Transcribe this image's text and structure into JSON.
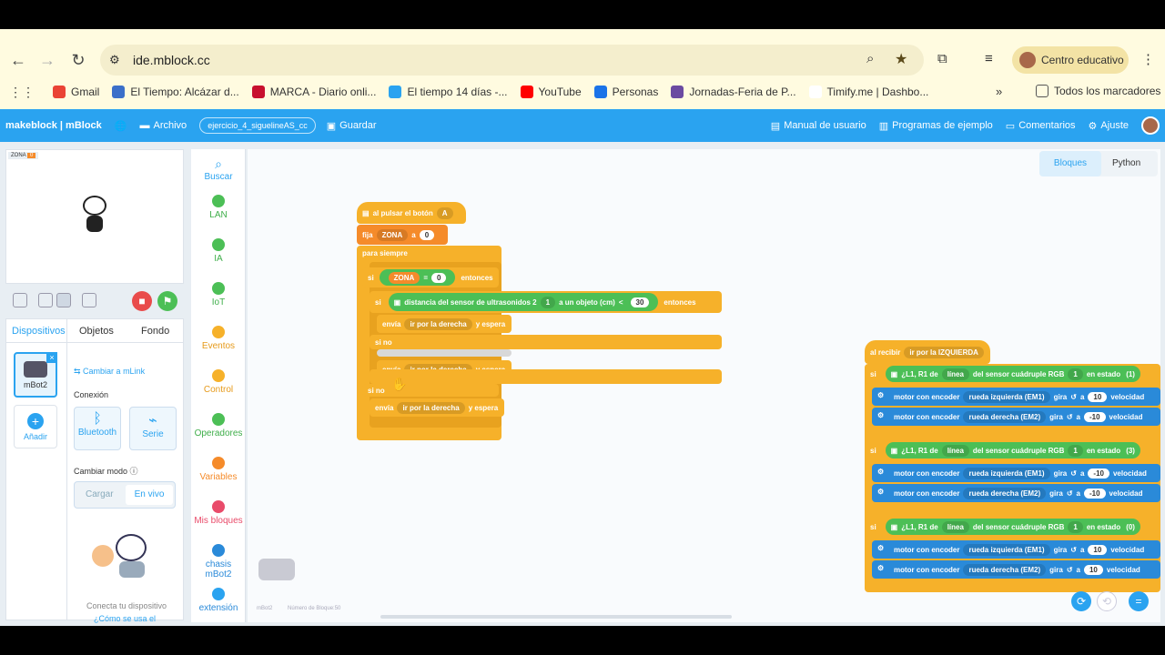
{
  "browser": {
    "url": "ide.mblock.cc",
    "profile_label": "Centro educativo",
    "bookmarks": [
      {
        "label": "Gmail",
        "color": "#ea4335"
      },
      {
        "label": "El Tiempo: Alcázar d...",
        "color": "#3b6fc9"
      },
      {
        "label": "MARCA - Diario onli...",
        "color": "#c8102e"
      },
      {
        "label": "El tiempo 14 días -...",
        "color": "#2aa3f0"
      },
      {
        "label": "YouTube",
        "color": "#ff0000"
      },
      {
        "label": "Personas",
        "color": "#1a73e8"
      },
      {
        "label": "Jornadas-Feria de P...",
        "color": "#6b4aa1"
      },
      {
        "label": "Timify.me | Dashbo...",
        "color": "#ffffff"
      }
    ],
    "all_bookmarks_label": "Todos los marcadores"
  },
  "mblock": {
    "logo": "makeblock | mBlock",
    "archivo": "Archivo",
    "project_name": "ejercicio_4_siguelineAS_cc",
    "guardar": "Guardar",
    "manual": "Manual de usuario",
    "ejemplos": "Programas de ejemplo",
    "comentarios": "Comentarios",
    "ajuste": "Ajuste"
  },
  "stage": {
    "variable_label": "ZONA",
    "variable_value": "0"
  },
  "devices_panel": {
    "tabs": [
      "Dispositivos",
      "Objetos",
      "Fondo"
    ],
    "device_name": "mBot2",
    "add_label": "Añadir",
    "switch_mlink": "Cambiar a mLink",
    "conexion": "Conexión",
    "bluetooth": "Bluetooth",
    "serie": "Serie",
    "cambiar_modo": "Cambiar modo",
    "cargar": "Cargar",
    "en_vivo": "En vivo",
    "connect_hint": "Conecta tu dispositivo",
    "how_to": "¿Cómo se usa el"
  },
  "categories": [
    {
      "label": "Buscar",
      "color": "#2aa3f0"
    },
    {
      "label": "LAN",
      "color": "#4cbf56"
    },
    {
      "label": "IA",
      "color": "#4cbf56"
    },
    {
      "label": "IoT",
      "color": "#4cbf56"
    },
    {
      "label": "Eventos",
      "color": "#f6b12a"
    },
    {
      "label": "Control",
      "color": "#f6b12a"
    },
    {
      "label": "Operadores",
      "color": "#4cbf56"
    },
    {
      "label": "Variables",
      "color": "#f58b2a"
    },
    {
      "label": "Mis bloques",
      "color": "#e94b6a"
    },
    {
      "label": "chasis mBot2",
      "color": "#2a8ad9"
    },
    {
      "label": "extensión",
      "color": "#2aa3f0"
    }
  ],
  "editor_tabs": {
    "bloques": "Bloques",
    "python": "Python"
  },
  "script1": {
    "hat": "al pulsar el botón",
    "hat_button": "A",
    "set_label": "fija",
    "set_var": "ZONA",
    "set_to": "a",
    "set_value": "0",
    "forever": "para siempre",
    "if1": "si",
    "cond_var": "ZONA",
    "cond_op": "=",
    "cond_value": "0",
    "then": "entonces",
    "if2": "si",
    "sensor": "distancia del sensor de ultrasonidos 2",
    "sensor_port": "1",
    "sensor_to": "a un objeto (cm)",
    "sensor_op": "<",
    "sensor_value": "30",
    "then2": "entonces",
    "send1": "envía",
    "msg1": "ir por la derecha",
    "wait1": "y espera",
    "else1": "si no",
    "send2": "envía",
    "msg2": "ir por la derecha",
    "wait2": "y espera",
    "else2": "si no",
    "send3": "envía",
    "msg3": "ir por la derecha",
    "wait3": "y espera"
  },
  "script2": {
    "hat": "al recibir",
    "hat_msg": "ir por la IZQUIERDA",
    "if": "si",
    "cond_text": "¿L1, R1 de",
    "cond_line": "línea",
    "cond_sensor": "del sensor cuádruple RGB",
    "cond_port": "1",
    "cond_state": "en estado",
    "state1": "(1)",
    "state2": "(3)",
    "state3": "(0)",
    "motor": "motor con encoder",
    "left_wheel": "rueda izquierda (EM1)",
    "right_wheel": "rueda derecha (EM2)",
    "gira": "gira",
    "a": "a",
    "vel": "velocidad",
    "v1l": "10",
    "v1r": "-10",
    "v2l": "-10",
    "v2r": "-10",
    "v3l": "10",
    "v3r": "10"
  },
  "footer": {
    "device": "mBot2",
    "blocks": "Número de Bloque:50"
  }
}
